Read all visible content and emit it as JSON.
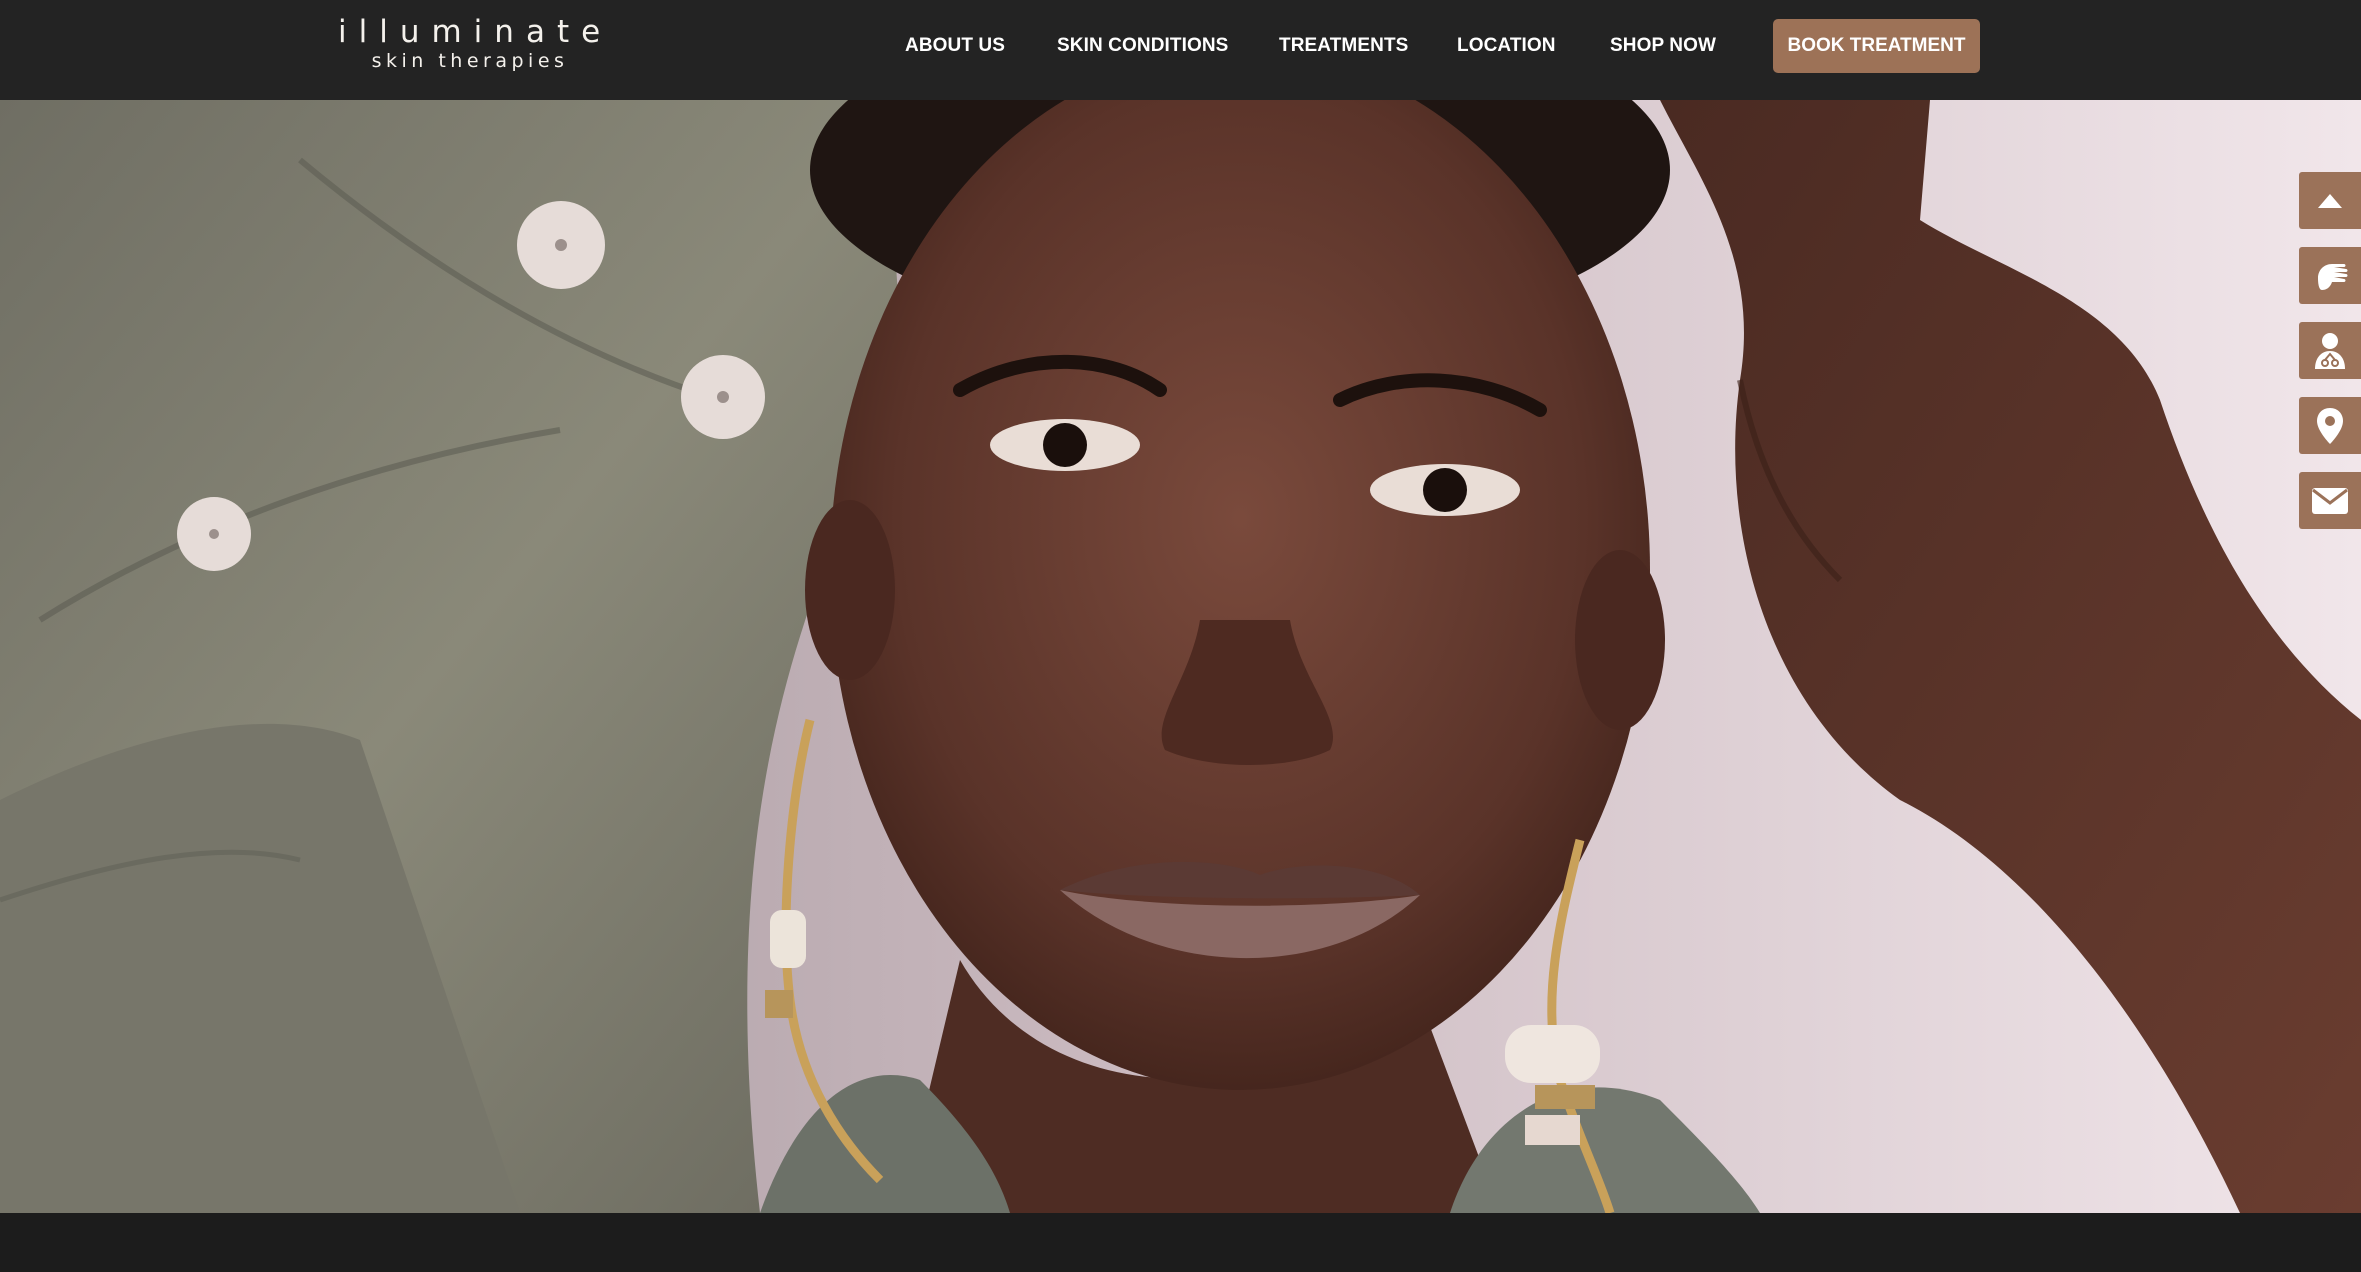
{
  "brand": {
    "logo_main": "illuminate",
    "logo_sub": "skin therapies"
  },
  "nav": {
    "items": [
      {
        "label": "ABOUT US"
      },
      {
        "label": "SKIN CONDITIONS"
      },
      {
        "label": "TREATMENTS"
      },
      {
        "label": "LOCATION"
      },
      {
        "label": "SHOP NOW"
      }
    ],
    "cta_label": "BOOK TREATMENT"
  },
  "hero": {
    "image": "hero-portrait-woman-gold-earrings"
  },
  "side_toolbar": {
    "icons": [
      "chevron-up-icon",
      "hand-icon",
      "consultant-icon",
      "map-pin-icon",
      "mail-icon"
    ]
  },
  "colors": {
    "header_bg": "#232323",
    "accent": "#9d7257",
    "page_bg": "#1c1c1c"
  }
}
